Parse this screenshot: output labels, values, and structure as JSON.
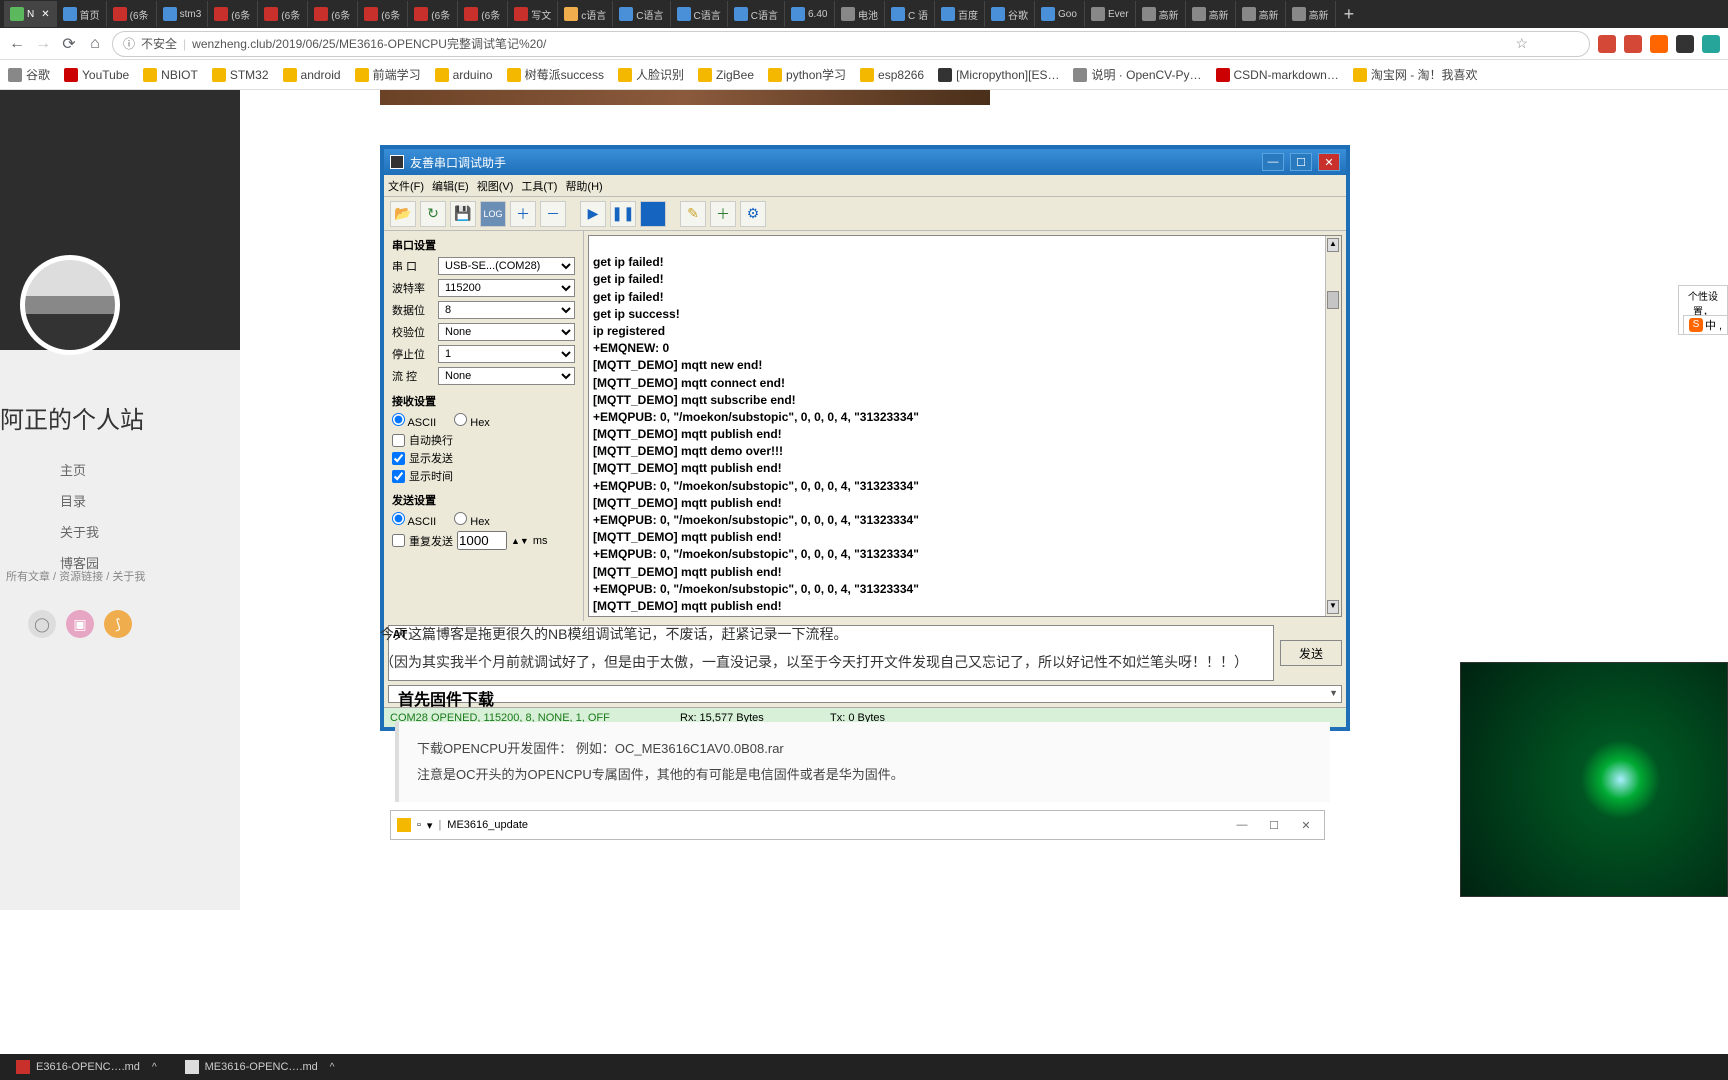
{
  "browser": {
    "tabs": [
      {
        "label": "N",
        "fav": "fav-green",
        "active": true
      },
      {
        "label": "首页",
        "fav": "fav-blue"
      },
      {
        "label": "(6条",
        "fav": "fav-red"
      },
      {
        "label": "stm3",
        "fav": "fav-blue"
      },
      {
        "label": "(6条",
        "fav": "fav-red"
      },
      {
        "label": "(6条",
        "fav": "fav-red"
      },
      {
        "label": "(6条",
        "fav": "fav-red"
      },
      {
        "label": "(6条",
        "fav": "fav-red"
      },
      {
        "label": "(6条",
        "fav": "fav-red"
      },
      {
        "label": "(6条",
        "fav": "fav-red"
      },
      {
        "label": "写文",
        "fav": "fav-red"
      },
      {
        "label": "c语言",
        "fav": "fav-orange"
      },
      {
        "label": "C语言",
        "fav": "fav-blue"
      },
      {
        "label": "C语言",
        "fav": "fav-blue"
      },
      {
        "label": "C语言",
        "fav": "fav-blue"
      },
      {
        "label": "6.40",
        "fav": "fav-blue"
      },
      {
        "label": "电池",
        "fav": ""
      },
      {
        "label": "C 语",
        "fav": "fav-blue"
      },
      {
        "label": "百度",
        "fav": "fav-blue"
      },
      {
        "label": "谷歌",
        "fav": "fav-blue"
      },
      {
        "label": "Goo",
        "fav": "fav-blue"
      },
      {
        "label": "Ever",
        "fav": ""
      },
      {
        "label": "高新",
        "fav": ""
      },
      {
        "label": "高新",
        "fav": ""
      },
      {
        "label": "高新",
        "fav": ""
      },
      {
        "label": "高新",
        "fav": ""
      }
    ],
    "newtab": "+",
    "security_label": "不安全",
    "url": "wenzheng.club/2019/06/25/ME3616-OPENCPU完整调试笔记%20/",
    "star": "☆",
    "bookmarks": [
      {
        "label": "谷歌",
        "icon": "gray"
      },
      {
        "label": "YouTube",
        "icon": "red"
      },
      {
        "label": "NBIOT",
        "icon": "bmicon"
      },
      {
        "label": "STM32",
        "icon": "bmicon"
      },
      {
        "label": "android",
        "icon": "bmicon"
      },
      {
        "label": "前端学习",
        "icon": "bmicon"
      },
      {
        "label": "arduino",
        "icon": "bmicon"
      },
      {
        "label": "树莓派success",
        "icon": "bmicon"
      },
      {
        "label": "人脸识别",
        "icon": "bmicon"
      },
      {
        "label": "ZigBee",
        "icon": "bmicon"
      },
      {
        "label": "python学习",
        "icon": "bmicon"
      },
      {
        "label": "esp8266",
        "icon": "bmicon"
      },
      {
        "label": "[Micropython][ES…",
        "icon": "dark"
      },
      {
        "label": "说明 · OpenCV-Py…",
        "icon": "gray"
      },
      {
        "label": "CSDN-markdown…",
        "icon": "red"
      },
      {
        "label": "淘宝网 - 淘！我喜欢",
        "icon": "bmicon"
      }
    ]
  },
  "site": {
    "title": "阿正的个人站",
    "nav": [
      "主页",
      "目录",
      "关于我",
      "博客园"
    ],
    "sub": "所有文章 / 资源链接 / 关于我"
  },
  "serial": {
    "title": "友善串口调试助手",
    "menu": [
      "文件(F)",
      "编辑(E)",
      "视图(V)",
      "工具(T)",
      "帮助(H)"
    ],
    "left": {
      "port_section": "串口设置",
      "port_label": "串 口",
      "port_value": "USB-SE...(COM28)",
      "baud_label": "波特率",
      "baud_value": "115200",
      "databits_label": "数据位",
      "databits_value": "8",
      "parity_label": "校验位",
      "parity_value": "None",
      "stop_label": "停止位",
      "stop_value": "1",
      "flow_label": "流 控",
      "flow_value": "None",
      "recv_section": "接收设置",
      "ascii": "ASCII",
      "hex": "Hex",
      "auto_wrap": "自动换行",
      "show_send": "显示发送",
      "show_time": "显示时间",
      "send_section": "发送设置",
      "repeat_label": "重复发送",
      "repeat_value": "1000",
      "repeat_unit": "ms"
    },
    "output": "get ip failed!\nget ip failed!\nget ip failed!\nget ip success!\nip registered\n+EMQNEW: 0\n[MQTT_DEMO] mqtt new end!\n[MQTT_DEMO] mqtt connect end!\n[MQTT_DEMO] mqtt subscribe end!\n+EMQPUB: 0, \"/moekon/substopic\", 0, 0, 0, 4, \"31323334\"\n[MQTT_DEMO] mqtt publish end!\n[MQTT_DEMO] mqtt demo over!!!\n[MQTT_DEMO] mqtt publish end!\n+EMQPUB: 0, \"/moekon/substopic\", 0, 0, 0, 4, \"31323334\"\n[MQTT_DEMO] mqtt publish end!\n+EMQPUB: 0, \"/moekon/substopic\", 0, 0, 0, 4, \"31323334\"\n[MQTT_DEMO] mqtt publish end!\n+EMQPUB: 0, \"/moekon/substopic\", 0, 0, 0, 4, \"31323334\"\n[MQTT_DEMO] mqtt publish end!\n+EMQPUB: 0, \"/moekon/substopic\", 0, 0, 0, 4, \"31323334\"\n[MQTT_DEMO] mqtt publish end!",
    "input": "AT",
    "send_btn": "发送",
    "status": {
      "conn": "COM28 OPENED, 115200, 8, NONE, 1, OFF",
      "rx": "Rx: 15,577 Bytes",
      "tx": "Tx: 0 Bytes"
    }
  },
  "article": {
    "p1": "今天这篇博客是拖更很久的NB模组调试笔记，不废话，赶紧记录一下流程。",
    "p2": "（因为其实我半个月前就调试好了，但是由于太傲，一直没记录，以至于今天打开文件发现自己又忘记了，所以好记性不如烂笔头呀！！！）",
    "h3": "首先固件下载",
    "code1": "下载OPENCPU开发固件：  例如：OC_ME3616C1AV0.0B08.rar",
    "code2": "注意是OC开头的为OPENCPU专属固件，其他的有可能是电信固件或者是华为固件。"
  },
  "explorer": {
    "path": "ME3616_update",
    "min": "—",
    "max": "☐",
    "close": "✕"
  },
  "right": {
    "tip": "个性设置，",
    "ime": "中 ,"
  },
  "taskbar": {
    "items": [
      {
        "label": "E3616-OPENC….md",
        "icon": "red"
      },
      {
        "label": "ME3616-OPENC….md",
        "icon": ""
      }
    ],
    "caret": "^"
  }
}
